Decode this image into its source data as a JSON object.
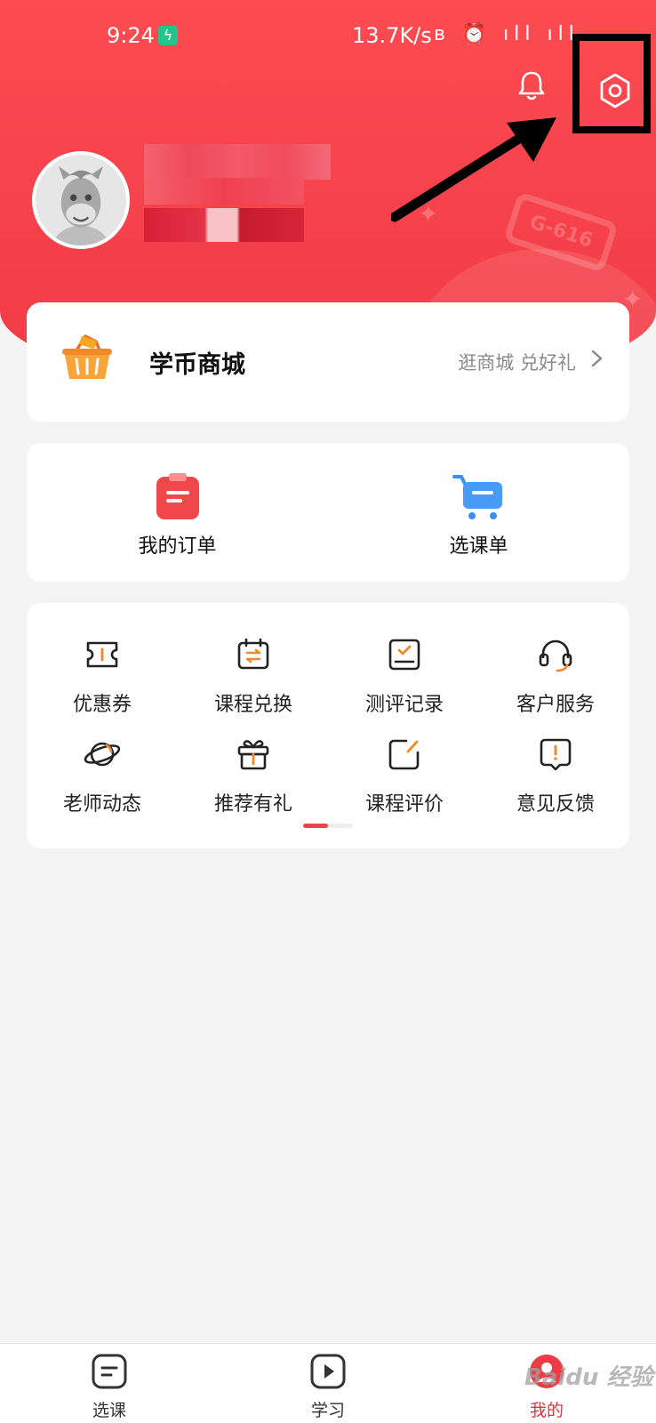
{
  "status_bar": {
    "time": "9:24",
    "network_speed": "13.7K/s",
    "icons": "ʙ ⏰ ıll ıll"
  },
  "header": {
    "badge_text": "G-616"
  },
  "mall": {
    "title": "学币商城",
    "subtitle": "逛商城 兑好礼"
  },
  "orders": [
    {
      "label": "我的订单",
      "icon": "order-clipboard-icon"
    },
    {
      "label": "选课单",
      "icon": "cart-icon"
    }
  ],
  "services": [
    {
      "label": "优惠券",
      "icon": "coupon-icon"
    },
    {
      "label": "课程兑换",
      "icon": "exchange-icon"
    },
    {
      "label": "测评记录",
      "icon": "assessment-icon"
    },
    {
      "label": "客户服务",
      "icon": "headset-icon"
    },
    {
      "label": "老师动态",
      "icon": "planet-icon"
    },
    {
      "label": "推荐有礼",
      "icon": "gift-icon"
    },
    {
      "label": "课程评价",
      "icon": "edit-icon"
    },
    {
      "label": "意见反馈",
      "icon": "feedback-icon"
    }
  ],
  "tabs": [
    {
      "label": "选课",
      "icon": "course-list-icon",
      "active": false
    },
    {
      "label": "学习",
      "icon": "play-icon",
      "active": false
    },
    {
      "label": "我的",
      "icon": "profile-icon",
      "active": true
    }
  ],
  "watermark": "Baidu 经验",
  "colors": {
    "primary": "#f13a45",
    "accent_orange": "#f08a2c",
    "accent_blue": "#3a8ff5"
  }
}
